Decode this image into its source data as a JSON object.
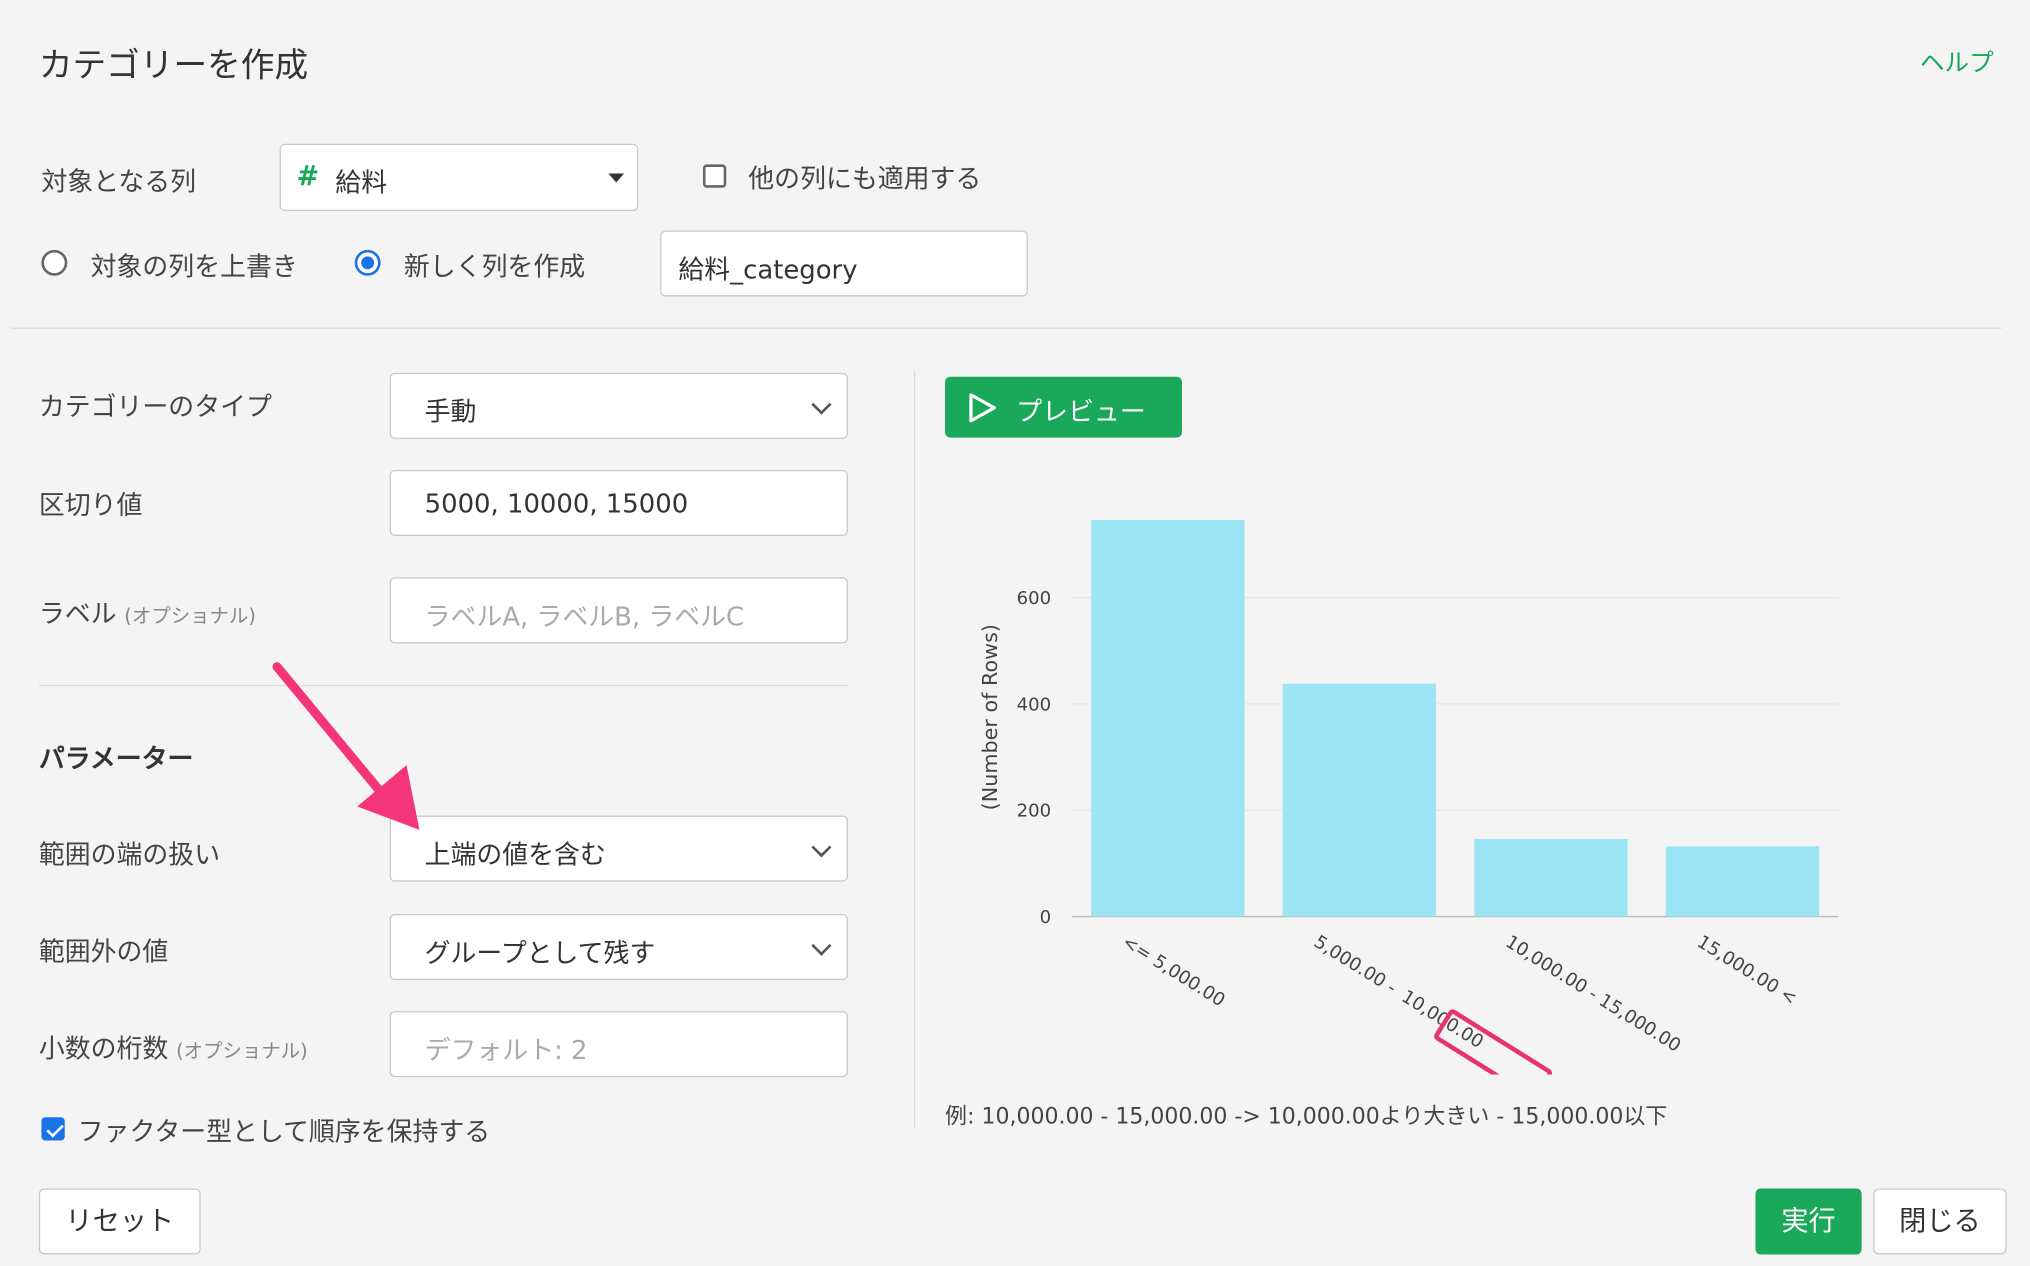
{
  "dialog": {
    "title": "カテゴリーを作成",
    "help": "ヘルプ"
  },
  "target": {
    "label": "対象となる列",
    "column": "給料",
    "column_icon": "#",
    "apply_other_label": "他の列にも適用する",
    "apply_other_checked": false
  },
  "output": {
    "overwrite_label": "対象の列を上書き",
    "new_label": "新しく列を作成",
    "selected": "new",
    "new_column_name": "給料_category"
  },
  "settings": {
    "type_label": "カテゴリーのタイプ",
    "type_value": "手動",
    "breaks_label": "区切り値",
    "breaks_value": "5000, 10000, 15000",
    "labels_label": "ラベル",
    "labels_optional": "(オプショナル)",
    "labels_placeholder": "ラベルA, ラベルB, ラベルC"
  },
  "params": {
    "heading": "パラメーター",
    "edge_label": "範囲の端の扱い",
    "edge_value": "上端の値を含む",
    "outside_label": "範囲外の値",
    "outside_value": "グループとして残す",
    "decimals_label": "小数の桁数",
    "decimals_optional": "(オプショナル)",
    "decimals_placeholder": "デフォルト: 2",
    "factor_label": "ファクター型として順序を保持する",
    "factor_checked": true
  },
  "preview": {
    "button": "プレビュー"
  },
  "chart_data": {
    "type": "bar",
    "categories": [
      "<= 5,000.00",
      "5,000.00 - 10,000.00",
      "10,000.00 - 15,000.00",
      "15,000.00 <"
    ],
    "cat_parts": [
      [
        "<= 5,000.00"
      ],
      [
        "5,000.00 -",
        "10,000.00"
      ],
      [
        "10,000.00 - 15,000.00"
      ],
      [
        "15,000.00 <"
      ]
    ],
    "values": [
      746,
      438,
      146,
      132
    ],
    "ylabel": "(Number of Rows)",
    "ylim": [
      0,
      750
    ],
    "yticks": [
      0,
      200,
      400,
      600
    ],
    "grid": true,
    "bar_color": "#9be4f4",
    "highlight_label": "10,000.00",
    "highlight_color": "#e8336f"
  },
  "example_text": "例: 10,000.00 - 15,000.00 -> 10,000.00より大きい - 15,000.00以下",
  "footer": {
    "reset": "リセット",
    "run": "実行",
    "close": "閉じる"
  },
  "colors": {
    "accent": "#1aa85a",
    "annotation_arrow": "#f5357a"
  }
}
